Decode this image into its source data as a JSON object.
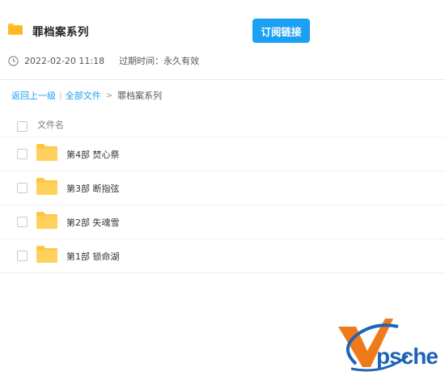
{
  "share": {
    "title": "罪档案系列",
    "subscribe_label": "订阅链接",
    "date": "2022-02-20 11:18",
    "expire": "过期时间：永久有效"
  },
  "breadcrumb": {
    "back": "返回上一级",
    "separator": "|",
    "all_files": "全部文件",
    "arrow": ">",
    "current": "罪档案系列"
  },
  "table": {
    "column_header": "文件名",
    "rows": [
      {
        "name": "第4部 焚心祭"
      },
      {
        "name": "第3部 断指弦"
      },
      {
        "name": "第2部 失魂雪"
      },
      {
        "name": "第1部 锁命湖"
      }
    ]
  },
  "watermark": {
    "text": "psche"
  },
  "colors": {
    "accent": "#1aa0f4",
    "folder": "#ffc53d",
    "watermark_orange": "#f07a1a",
    "watermark_blue": "#1e63b8"
  }
}
